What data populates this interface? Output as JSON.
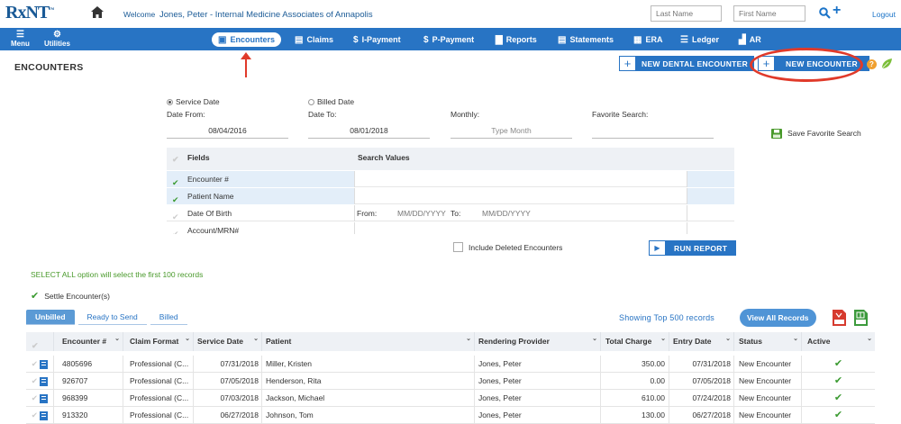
{
  "app": {
    "logo": "RxNT",
    "welcome_prefix": "Welcome",
    "welcome_user": "Jones, Peter - Internal Medicine Associates of Annapolis"
  },
  "top": {
    "last_name_placeholder": "Last Name",
    "first_name_placeholder": "First Name",
    "logout": "Logout"
  },
  "nav": {
    "menu": "Menu",
    "utilities": "Utilities",
    "items": [
      {
        "label": "Encounters",
        "icon": "encounters-icon"
      },
      {
        "label": "Claims",
        "icon": "claims-icon"
      },
      {
        "label": "I-Payment",
        "icon": "dollar-icon"
      },
      {
        "label": "P-Payment",
        "icon": "dollar-icon"
      },
      {
        "label": "Reports",
        "icon": "reports-icon"
      },
      {
        "label": "Statements",
        "icon": "statements-icon"
      },
      {
        "label": "ERA",
        "icon": "era-icon"
      },
      {
        "label": "Ledger",
        "icon": "ledger-icon"
      },
      {
        "label": "AR",
        "icon": "bar-chart-icon"
      }
    ]
  },
  "page": {
    "title": "ENCOUNTERS",
    "new_dental_encounter": "NEW DENTAL ENCOUNTER",
    "new_encounter": "NEW ENCOUNTER"
  },
  "filters": {
    "service_date": "Service Date",
    "billed_date": "Billed Date",
    "date_from_label": "Date From:",
    "date_from": "08/04/2016",
    "date_to_label": "Date To:",
    "date_to": "08/01/2018",
    "monthly_label": "Monthly:",
    "monthly_placeholder": "Type Month",
    "favorite_label": "Favorite Search:",
    "save_favorite": "Save Favorite Search"
  },
  "fields_grid": {
    "col_fields": "Fields",
    "col_values": "Search Values",
    "rows": [
      {
        "label": "Encounter #",
        "checked": true
      },
      {
        "label": "Patient Name",
        "checked": true
      },
      {
        "label": "Date Of Birth",
        "checked": false
      },
      {
        "label": "Account/MRN#",
        "checked": false
      }
    ],
    "dob_from": "From:",
    "dob_from_ph": "MM/DD/YYYY",
    "dob_to": "To:",
    "dob_to_ph": "MM/DD/YYYY"
  },
  "include_deleted": "Include Deleted Encounters",
  "run_report": "RUN REPORT",
  "select_all_note": "SELECT ALL option will select the first 100 records",
  "settle_encounters": "Settle Encounter(s)",
  "tabs": [
    "Unbilled",
    "Ready to Send",
    "Billed"
  ],
  "showing": "Showing Top 500 records",
  "view_all": "View All Records",
  "table": {
    "headers": [
      "Encounter #",
      "Claim Format",
      "Service Date",
      "Patient",
      "Rendering Provider",
      "Total Charge",
      "Entry Date",
      "Status",
      "Active"
    ],
    "rows": [
      {
        "enc": "4805696",
        "format": "Professional (C...",
        "service": "07/31/2018",
        "patient": "Miller, Kristen",
        "provider": "Jones, Peter",
        "charge": "350.00",
        "entry": "07/31/2018",
        "status": "New Encounter"
      },
      {
        "enc": "926707",
        "format": "Professional (C...",
        "service": "07/05/2018",
        "patient": "Henderson, Rita",
        "provider": "Jones, Peter",
        "charge": "0.00",
        "entry": "07/05/2018",
        "status": "New Encounter"
      },
      {
        "enc": "968399",
        "format": "Professional (C...",
        "service": "07/03/2018",
        "patient": "Jackson, Michael",
        "provider": "Jones, Peter",
        "charge": "610.00",
        "entry": "07/24/2018",
        "status": "New Encounter"
      },
      {
        "enc": "913320",
        "format": "Professional (C...",
        "service": "06/27/2018",
        "patient": "Johnson, Tom",
        "provider": "Jones, Peter",
        "charge": "130.00",
        "entry": "06/27/2018",
        "status": "New Encounter"
      }
    ]
  },
  "colors": {
    "nav_blue": "#2874c4",
    "annotation_red": "#e03a2a",
    "check_green": "#3a9a30"
  }
}
